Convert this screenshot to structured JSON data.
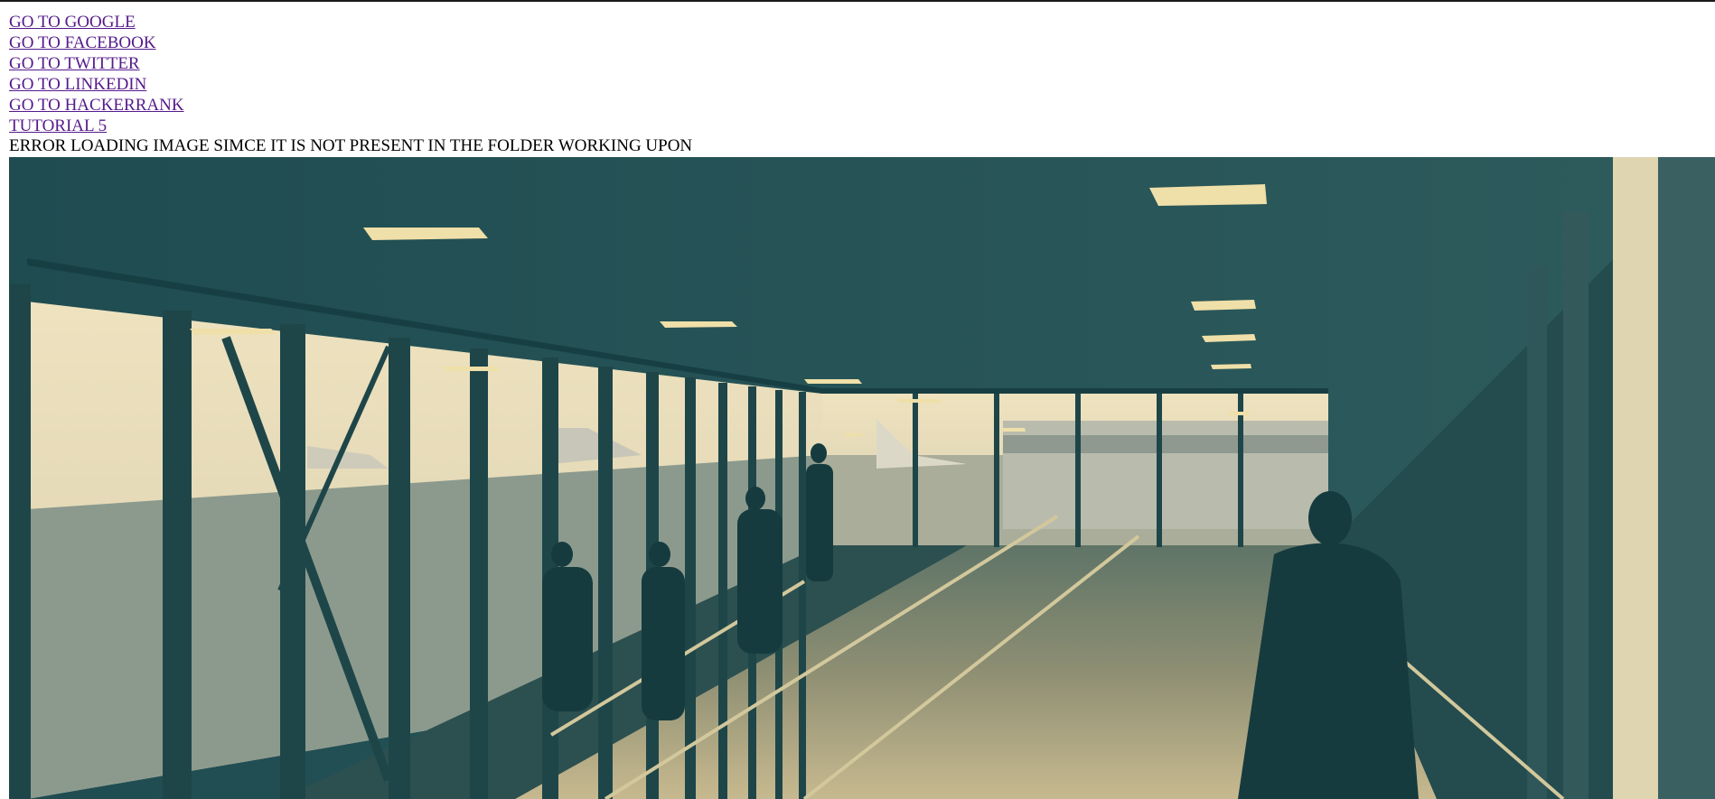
{
  "links": [
    {
      "label": "GO TO GOOGLE"
    },
    {
      "label": "GO TO FACEBOOK"
    },
    {
      "label": "GO TO TWITTER"
    },
    {
      "label": "GO TO LINKEDIN"
    },
    {
      "label": "GO TO HACKERRANK"
    },
    {
      "label": "TUTORIAL 5"
    }
  ],
  "broken_image": {
    "alt": "ERROR LOADING IMAGE SIMCE IT IS NOT PRESENT IN THE FOLDER WORKING UPON"
  },
  "colors": {
    "link": "#551a8b",
    "photo_ceiling": "#1d4a4f",
    "photo_sky": "#e6dcb8"
  }
}
